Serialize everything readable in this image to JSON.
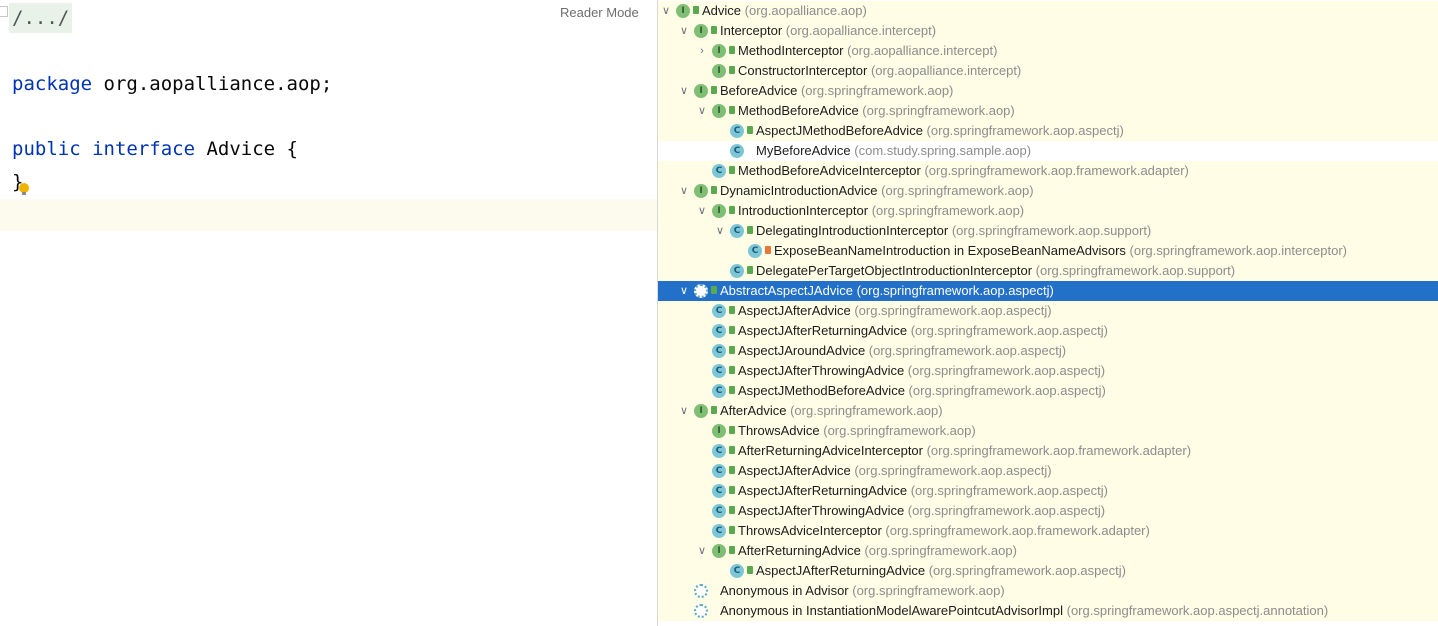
{
  "editor": {
    "collapsed_comment": "/.../",
    "reader_mode": "Reader Mode",
    "line_package_kw": "package",
    "line_package_rest": " org.aopalliance.aop;",
    "line_decl_kw1": "public",
    "line_decl_kw2": "interface",
    "line_decl_rest": " Advice {",
    "line_close": "}"
  },
  "hierarchy": {
    "rows": [
      {
        "depth": 0,
        "arrow": "down",
        "icon": "interface",
        "vis": "public",
        "name": "Advice",
        "pkg": "(org.aopalliance.aop)",
        "star": true,
        "highlight": true
      },
      {
        "depth": 1,
        "arrow": "down",
        "icon": "interface",
        "vis": "public",
        "name": "Interceptor",
        "pkg": "(org.aopalliance.intercept)",
        "highlight": true
      },
      {
        "depth": 2,
        "arrow": "right",
        "icon": "interface",
        "vis": "public",
        "name": "MethodInterceptor",
        "pkg": "(org.aopalliance.intercept)",
        "highlight": true
      },
      {
        "depth": 2,
        "arrow": "",
        "icon": "interface",
        "vis": "public",
        "name": "ConstructorInterceptor",
        "pkg": "(org.aopalliance.intercept)",
        "highlight": true
      },
      {
        "depth": 1,
        "arrow": "down",
        "icon": "interface",
        "vis": "public",
        "name": "BeforeAdvice",
        "pkg": "(org.springframework.aop)",
        "highlight": true
      },
      {
        "depth": 2,
        "arrow": "down",
        "icon": "interface",
        "vis": "public",
        "name": "MethodBeforeAdvice",
        "pkg": "(org.springframework.aop)",
        "highlight": true
      },
      {
        "depth": 3,
        "arrow": "",
        "icon": "class",
        "vis": "public",
        "name": "AspectJMethodBeforeAdvice",
        "pkg": "(org.springframework.aop.aspectj)",
        "highlight": true
      },
      {
        "depth": 3,
        "arrow": "",
        "icon": "class",
        "vis": "",
        "name": "MyBeforeAdvice",
        "pkg": "(com.study.spring.sample.aop)",
        "highlight": false
      },
      {
        "depth": 2,
        "arrow": "",
        "icon": "class",
        "vis": "public",
        "name": "MethodBeforeAdviceInterceptor",
        "pkg": "(org.springframework.aop.framework.adapter)",
        "highlight": true
      },
      {
        "depth": 1,
        "arrow": "down",
        "icon": "interface",
        "vis": "public",
        "name": "DynamicIntroductionAdvice",
        "pkg": "(org.springframework.aop)",
        "highlight": true
      },
      {
        "depth": 2,
        "arrow": "down",
        "icon": "interface",
        "vis": "public",
        "name": "IntroductionInterceptor",
        "pkg": "(org.springframework.aop)",
        "highlight": true
      },
      {
        "depth": 3,
        "arrow": "down",
        "icon": "class",
        "vis": "public",
        "name": "DelegatingIntroductionInterceptor",
        "pkg": "(org.springframework.aop.support)",
        "highlight": true
      },
      {
        "depth": 4,
        "arrow": "",
        "icon": "class",
        "vis": "private",
        "name": "ExposeBeanNameIntroduction in ExposeBeanNameAdvisors",
        "pkg": "(org.springframework.aop.interceptor)",
        "highlight": true
      },
      {
        "depth": 3,
        "arrow": "",
        "icon": "class",
        "vis": "public",
        "name": "DelegatePerTargetObjectIntroductionInterceptor",
        "pkg": "(org.springframework.aop.support)",
        "highlight": true
      },
      {
        "depth": 1,
        "arrow": "down",
        "icon": "abstract",
        "vis": "public",
        "name": "AbstractAspectJAdvice",
        "pkg": "(org.springframework.aop.aspectj)",
        "selected": true
      },
      {
        "depth": 2,
        "arrow": "",
        "icon": "class",
        "vis": "public",
        "name": "AspectJAfterAdvice",
        "pkg": "(org.springframework.aop.aspectj)",
        "highlight": true
      },
      {
        "depth": 2,
        "arrow": "",
        "icon": "class",
        "vis": "public",
        "name": "AspectJAfterReturningAdvice",
        "pkg": "(org.springframework.aop.aspectj)",
        "highlight": true
      },
      {
        "depth": 2,
        "arrow": "",
        "icon": "class",
        "vis": "public",
        "name": "AspectJAroundAdvice",
        "pkg": "(org.springframework.aop.aspectj)",
        "highlight": true
      },
      {
        "depth": 2,
        "arrow": "",
        "icon": "class",
        "vis": "public",
        "name": "AspectJAfterThrowingAdvice",
        "pkg": "(org.springframework.aop.aspectj)",
        "highlight": true
      },
      {
        "depth": 2,
        "arrow": "",
        "icon": "class",
        "vis": "public",
        "name": "AspectJMethodBeforeAdvice",
        "pkg": "(org.springframework.aop.aspectj)",
        "highlight": true
      },
      {
        "depth": 1,
        "arrow": "down",
        "icon": "interface",
        "vis": "public",
        "name": "AfterAdvice",
        "pkg": "(org.springframework.aop)",
        "highlight": true
      },
      {
        "depth": 2,
        "arrow": "",
        "icon": "interface",
        "vis": "public",
        "name": "ThrowsAdvice",
        "pkg": "(org.springframework.aop)",
        "highlight": true
      },
      {
        "depth": 2,
        "arrow": "",
        "icon": "class",
        "vis": "public",
        "name": "AfterReturningAdviceInterceptor",
        "pkg": "(org.springframework.aop.framework.adapter)",
        "highlight": true
      },
      {
        "depth": 2,
        "arrow": "",
        "icon": "class",
        "vis": "public",
        "name": "AspectJAfterAdvice",
        "pkg": "(org.springframework.aop.aspectj)",
        "highlight": true
      },
      {
        "depth": 2,
        "arrow": "",
        "icon": "class",
        "vis": "public",
        "name": "AspectJAfterReturningAdvice",
        "pkg": "(org.springframework.aop.aspectj)",
        "highlight": true
      },
      {
        "depth": 2,
        "arrow": "",
        "icon": "class",
        "vis": "public",
        "name": "AspectJAfterThrowingAdvice",
        "pkg": "(org.springframework.aop.aspectj)",
        "highlight": true
      },
      {
        "depth": 2,
        "arrow": "",
        "icon": "class",
        "vis": "public",
        "name": "ThrowsAdviceInterceptor",
        "pkg": "(org.springframework.aop.framework.adapter)",
        "highlight": true
      },
      {
        "depth": 2,
        "arrow": "down",
        "icon": "interface",
        "vis": "public",
        "name": "AfterReturningAdvice",
        "pkg": "(org.springframework.aop)",
        "highlight": true
      },
      {
        "depth": 3,
        "arrow": "",
        "icon": "class",
        "vis": "public",
        "name": "AspectJAfterReturningAdvice",
        "pkg": "(org.springframework.aop.aspectj)",
        "highlight": true
      },
      {
        "depth": 1,
        "arrow": "",
        "icon": "anonymous",
        "vis": "",
        "name": "Anonymous in Advisor",
        "pkg": "(org.springframework.aop)",
        "highlight": true
      },
      {
        "depth": 1,
        "arrow": "",
        "icon": "anonymous",
        "vis": "",
        "name": "Anonymous in InstantiationModelAwarePointcutAdvisorImpl",
        "pkg": "(org.springframework.aop.aspectj.annotation)",
        "highlight": true
      }
    ]
  }
}
